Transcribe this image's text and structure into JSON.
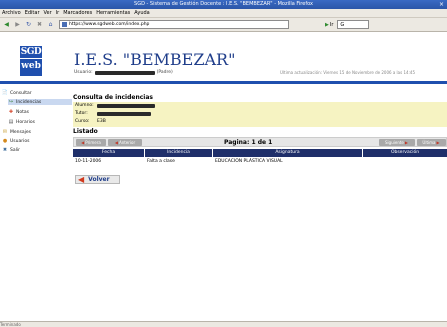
{
  "window": {
    "title": "SGD - Sistema de Gestión Docente : I.E.S. \"BEMBEZAR\" - Mozilla Firefox",
    "close": "×"
  },
  "menu": [
    "Archivo",
    "Editar",
    "Ver",
    "Ir",
    "Marcadores",
    "Herramientas",
    "Ayuda"
  ],
  "nav": {
    "back": "◀",
    "forward": "▶",
    "reload": "↻",
    "stop": "✖",
    "home": "⌂",
    "url": "https://www.sgdweb.com/index.php",
    "go": "Ir",
    "go_icon": "▶",
    "search_value": "G"
  },
  "header": {
    "logo_line1": "SGD",
    "logo_line2": "web",
    "school": "I.E.S. \"BEMBEZAR\"",
    "user_label": "Usuario:",
    "user_suffix": "(Padre)",
    "right_info": "Última actualización: Viernes 15 de Noviembre de 2006 a las 14:45"
  },
  "sidebar": {
    "items": [
      {
        "label": "Consultar",
        "icon": "📄"
      },
      {
        "label": "Incidencias",
        "icon": "↪"
      },
      {
        "label": "Notas",
        "icon": "✚"
      },
      {
        "label": "Horarios",
        "icon": "▤"
      },
      {
        "label": "Mensajes",
        "icon": "✉"
      },
      {
        "label": "Usuarios",
        "icon": "●"
      },
      {
        "label": "Salir",
        "icon": "✖"
      }
    ]
  },
  "content": {
    "title": "Consulta de incidencias",
    "info": [
      {
        "label": "Alumno:"
      },
      {
        "label": "Tutor:"
      },
      {
        "label": "Curso:",
        "value": "E3B"
      }
    ],
    "listado": "Listado",
    "pager": {
      "label": "Pagina: 1 de 1",
      "first": "Primera",
      "prev": "Anterior",
      "next": "Siguiente",
      "last": "Última"
    },
    "table": {
      "headers": [
        "Fecha",
        "Incidencia",
        "Asignatura",
        "Observación"
      ],
      "rows": [
        [
          "10-11-2006",
          "Falta a clase",
          "EDUCACIÓN PLÁSTICA VISUAL",
          ""
        ]
      ]
    },
    "back_button": "Volver"
  },
  "status": {
    "text": "Terminado"
  },
  "colors": {
    "accent": "#1f4fae",
    "table_header": "#1f2f6a",
    "info_bg": "#f6f3c2"
  }
}
